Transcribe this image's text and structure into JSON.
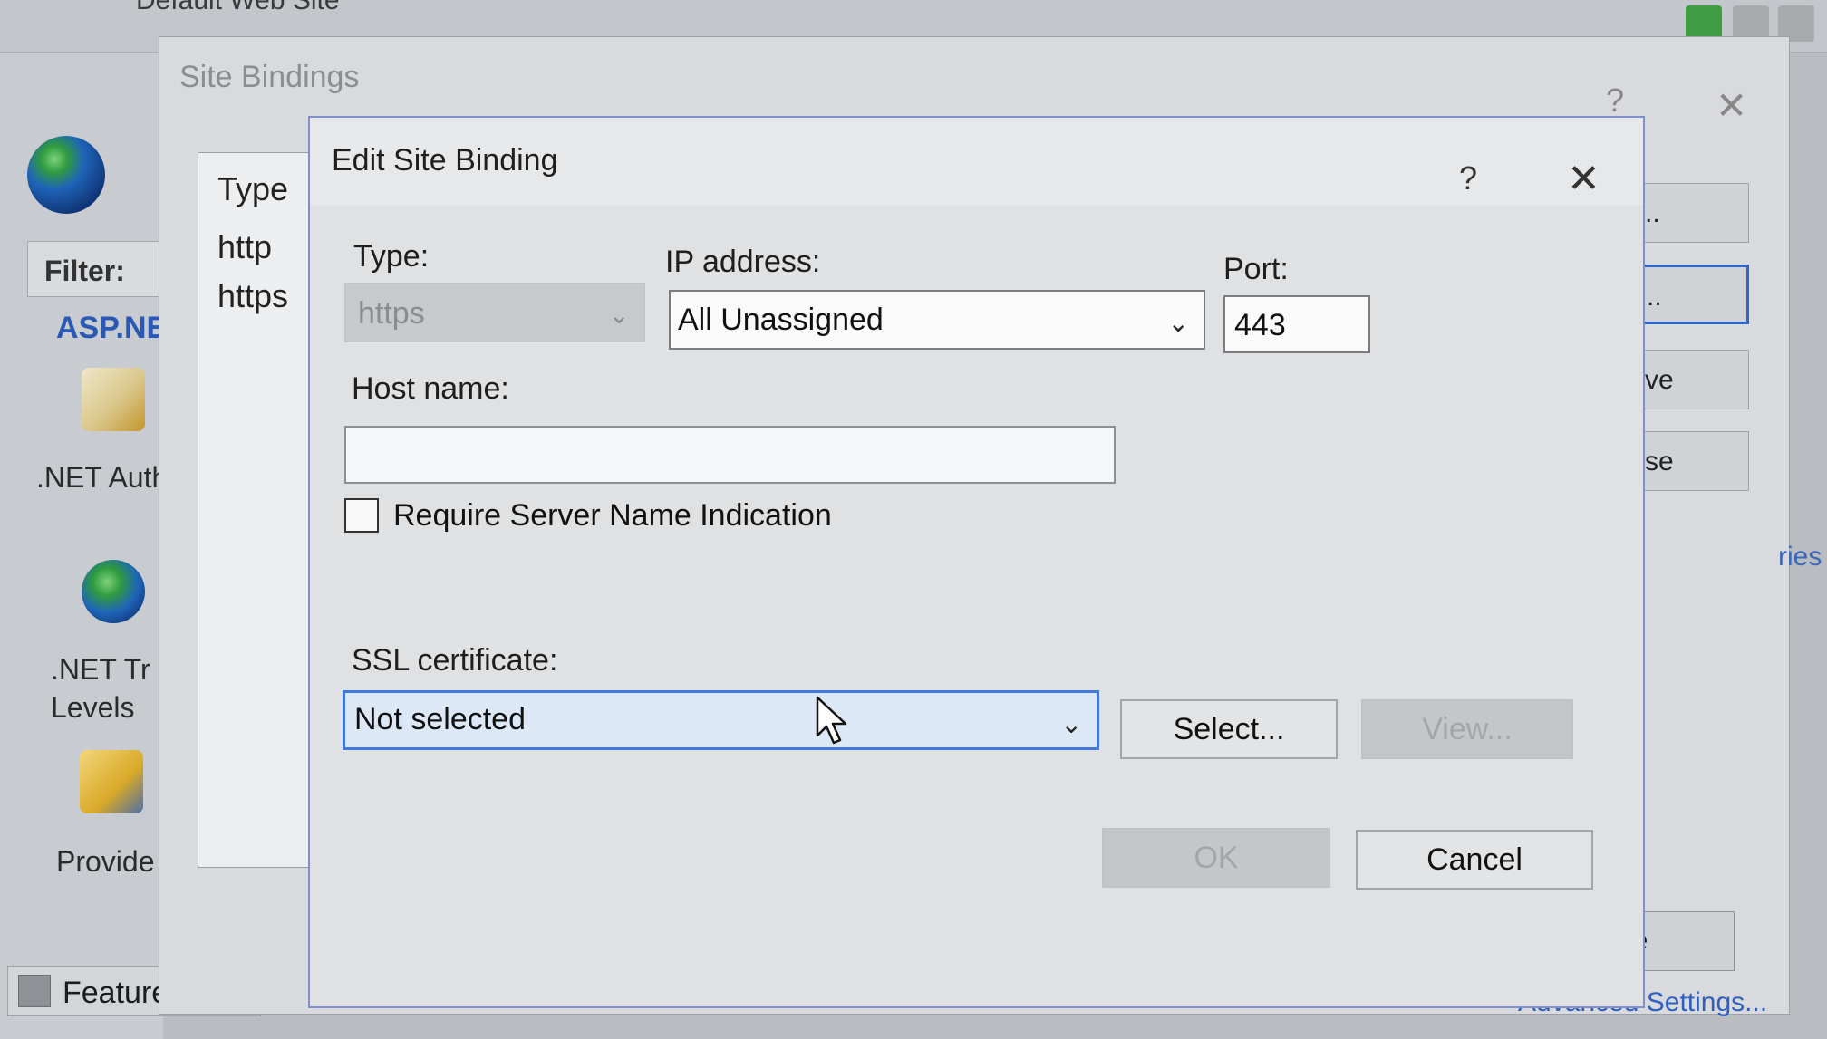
{
  "background": {
    "breadcrumb": "Default Web Site",
    "filter_label": "Filter:",
    "section_label": "ASP.NE",
    "features": [
      {
        "label": ".NET Authoriz",
        "icon": "lock-document-icon"
      },
      {
        "label": ".NET Tr Levels",
        "icon": "globe-check-icon"
      },
      {
        "label": "Provide",
        "icon": "users-database-icon"
      }
    ],
    "feature_view_label": "Feature"
  },
  "site_bindings": {
    "title": "Site Bindings",
    "help": "?",
    "close_glyph": "✕",
    "list_header": "Type",
    "rows": [
      "http",
      "https"
    ],
    "side_buttons": [
      "..",
      "..",
      "ve",
      "se"
    ],
    "side_link": "ries",
    "close_button": "Close",
    "advanced_link": "Advanced Settings..."
  },
  "edit_binding": {
    "title": "Edit Site Binding",
    "help": "?",
    "close_glyph": "✕",
    "type_label": "Type:",
    "type_value": "https",
    "ip_label": "IP address:",
    "ip_value": "All Unassigned",
    "port_label": "Port:",
    "port_value": "443",
    "host_label": "Host name:",
    "host_value": "",
    "sni_label": "Require Server Name Indication",
    "sni_checked": false,
    "ssl_label": "SSL certificate:",
    "ssl_value": "Not selected",
    "select_button": "Select...",
    "view_button": "View...",
    "ok_button": "OK",
    "cancel_button": "Cancel"
  },
  "colors": {
    "accent": "#3f78d8",
    "link": "#2a59b5",
    "disabled_text": "#a4a6a9"
  }
}
